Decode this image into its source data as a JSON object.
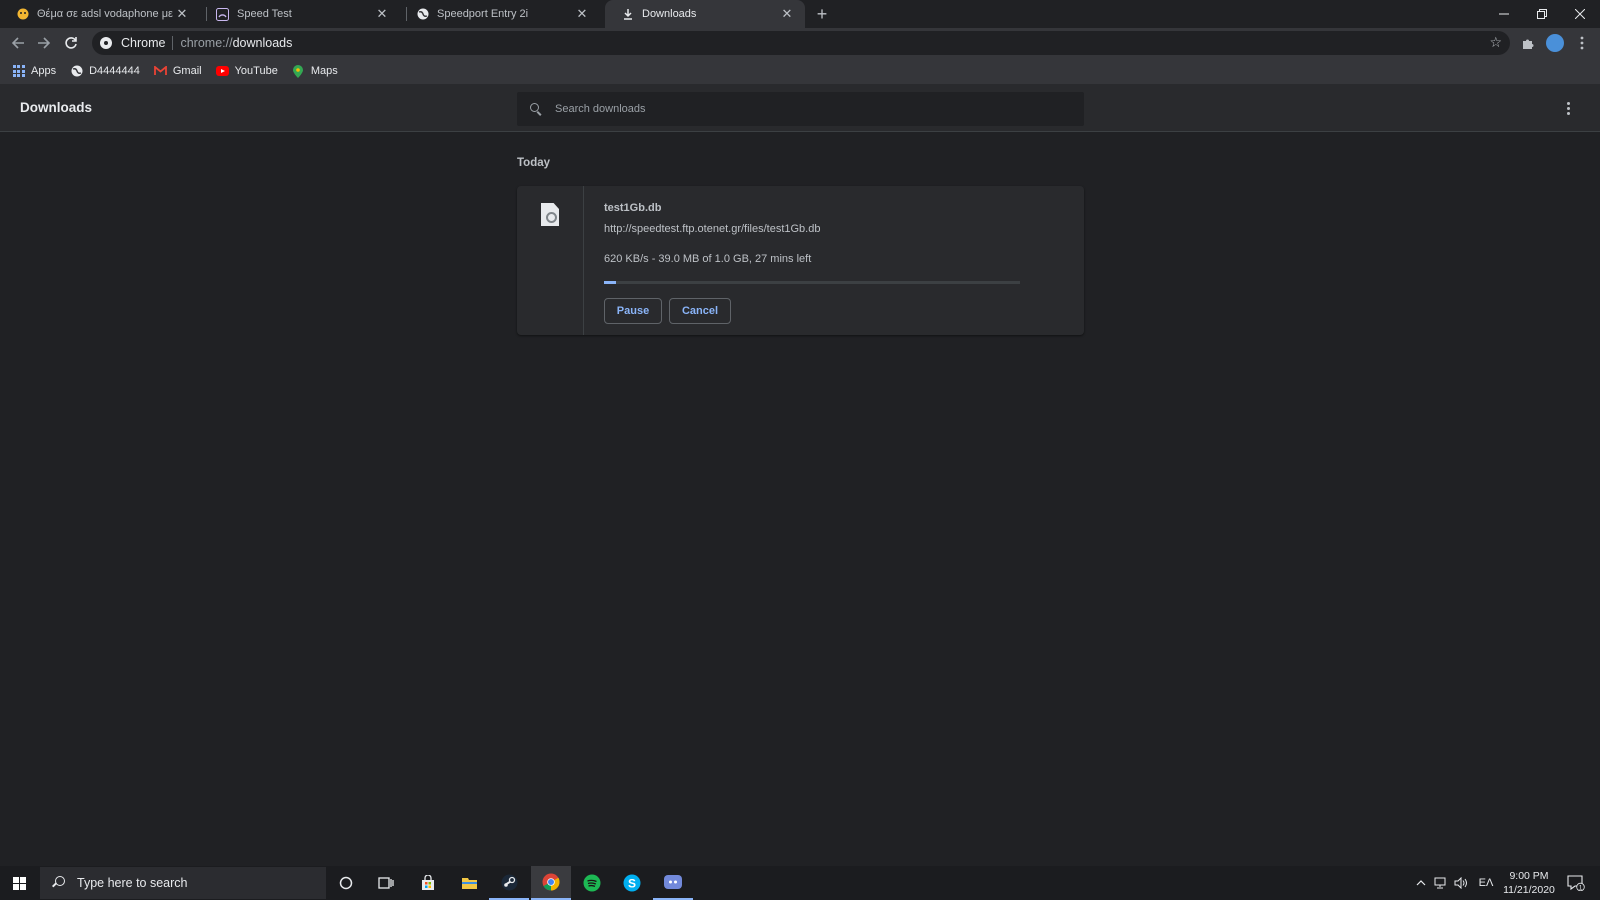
{
  "tabs": [
    {
      "title": "Θέμα σε adsl vodaphone με dow",
      "favicon": "forum-favicon",
      "active": false
    },
    {
      "title": "Speed Test",
      "favicon": "speedtest-favicon",
      "active": false
    },
    {
      "title": "Speedport Entry 2i",
      "favicon": "globe-icon",
      "active": false
    },
    {
      "title": "Downloads",
      "favicon": "download-icon",
      "active": true
    }
  ],
  "toolbar": {
    "site_chip": "Chrome",
    "url_scheme": "chrome://",
    "url_path": "downloads"
  },
  "bookmarks": [
    {
      "label": "Apps",
      "icon": "apps-icon"
    },
    {
      "label": "D4444444",
      "icon": "globe-icon"
    },
    {
      "label": "Gmail",
      "icon": "gmail-icon"
    },
    {
      "label": "YouTube",
      "icon": "youtube-icon"
    },
    {
      "label": "Maps",
      "icon": "maps-icon"
    }
  ],
  "page": {
    "title": "Downloads",
    "search_placeholder": "Search downloads"
  },
  "downloads": {
    "section": "Today",
    "item": {
      "filename": "test1Gb.db",
      "url": "http://speedtest.ftp.otenet.gr/files/test1Gb.db",
      "status": "620 KB/s - 39.0 MB of 1.0 GB, 27 mins left",
      "progress_fraction": 0.03,
      "pause_label": "Pause",
      "cancel_label": "Cancel"
    }
  },
  "taskbar": {
    "search_placeholder": "Type here to search",
    "language": "ΕΛ",
    "time": "9:00 PM",
    "date": "11/21/2020",
    "notification_count": "1"
  },
  "colors": {
    "accent": "#8ab4f8",
    "background": "#202124",
    "surface": "#292a2d"
  }
}
